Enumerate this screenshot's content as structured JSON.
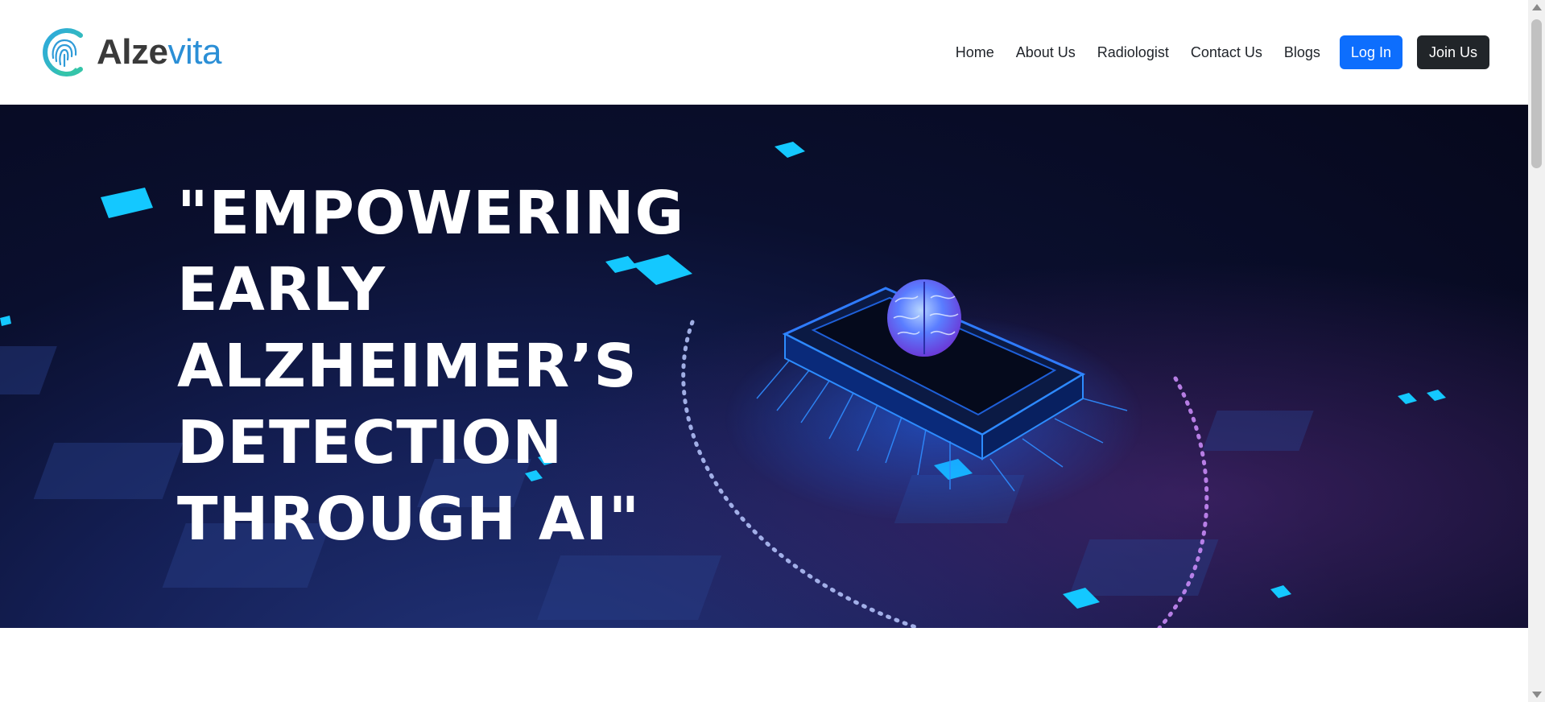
{
  "brand": {
    "name_part1": "Alze",
    "name_part2": "vita"
  },
  "nav": {
    "links": [
      "Home",
      "About Us",
      "Radiologist",
      "Contact Us",
      "Blogs"
    ],
    "login_label": "Log In",
    "join_label": "Join Us"
  },
  "hero": {
    "headline_lines": [
      "\"EMPOWERING",
      "EARLY",
      "ALZHEIMER’S",
      "DETECTION",
      "THROUGH AI\""
    ]
  },
  "colors": {
    "login_button": "#0d6efd",
    "join_button": "#212529",
    "logo_blue": "#2b8fd6",
    "logo_teal": "#35c6a6"
  },
  "icons": [
    "logo-mark-icon",
    "brain-chip-illustration",
    "scroll-up-icon",
    "scroll-down-icon"
  ]
}
